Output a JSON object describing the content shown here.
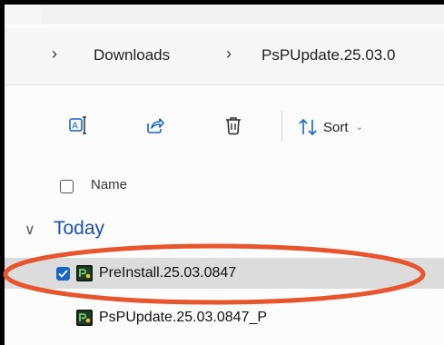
{
  "breadcrumb": {
    "items": [
      "Downloads",
      "PsPUpdate.25.03.0"
    ]
  },
  "toolbar": {
    "rename_icon": "rename-icon",
    "share_icon": "share-icon",
    "delete_icon": "delete-icon",
    "sort_label": "Sort"
  },
  "list": {
    "column_name": "Name",
    "group_label": "Today",
    "files": [
      {
        "name": "PreInstall.25.03.0847",
        "selected": true,
        "icon": "psp-app-icon"
      },
      {
        "name": "PsPUpdate.25.03.0847_P",
        "selected": false,
        "icon": "psp-app-icon"
      }
    ]
  },
  "colors": {
    "accent": "#1a66c8",
    "group_label": "#1a4fb5",
    "annotation_circle": "#e8542c"
  }
}
